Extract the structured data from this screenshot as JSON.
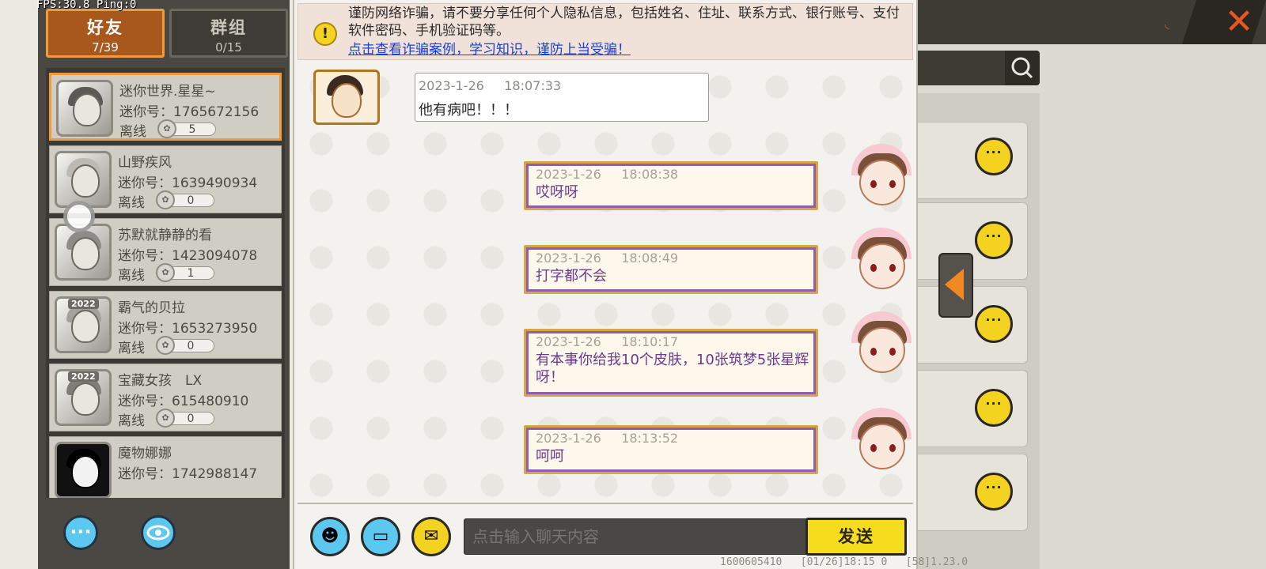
{
  "debug": {
    "fps": "FPS:30.8  Ping:0",
    "footer": "1600605410   [01/26]18:15 0   [58]1.23.0"
  },
  "tabs": {
    "friends": {
      "label": "好友",
      "count": "7/39"
    },
    "groups": {
      "label": "群组",
      "count": "0/15"
    }
  },
  "friends": [
    {
      "name": "迷你世界.星星~",
      "mini": "迷你号：1765672156",
      "status": "离线",
      "level": "5"
    },
    {
      "name": "山野疾风",
      "mini": "迷你号：1639490934",
      "status": "离线",
      "level": "0"
    },
    {
      "name": "苏默就静静的看",
      "mini": "迷你号：1423094078",
      "status": "离线",
      "level": "1"
    },
    {
      "name": "霸气的贝拉",
      "mini": "迷你号：1653273950",
      "status": "离线",
      "level": "0",
      "badge": "2022"
    },
    {
      "name": "宝藏女孩　LX",
      "mini": "迷你号：615480910",
      "status": "离线",
      "level": "0",
      "badge": "2022"
    },
    {
      "name": "魔物娜娜",
      "mini": "迷你号：1742988147",
      "status": "",
      "level": ""
    }
  ],
  "notice": {
    "text": "谨防网络诈骗，请不要分享任何个人隐私信息，包括姓名、住址、联系方式、银行账号、支付软件密码、手机验证码等。",
    "link": "点击查看诈骗案例，学习知识，谨防上当受骗！",
    "icon": "!"
  },
  "messages": [
    {
      "from": "friend",
      "time": "2023-1-26     18:07:33",
      "text": "他有病吧！！！"
    },
    {
      "from": "me",
      "time": "2023-1-26     18:08:38",
      "text": "哎呀呀"
    },
    {
      "from": "me",
      "time": "2023-1-26     18:08:49",
      "text": "打字都不会"
    },
    {
      "from": "me",
      "time": "2023-1-26     18:10:17",
      "text": "有本事你给我10个皮肤，10张筑梦5张星辉呀！"
    },
    {
      "from": "me",
      "time": "2023-1-26     18:13:52",
      "text": "呵呵"
    }
  ],
  "input": {
    "placeholder": "点击输入聊天内容",
    "send_label": "发送"
  },
  "icons": {
    "more": "more-icon",
    "eye": "eye-icon",
    "emoji": "emoji-icon",
    "keyboard": "keyboard-icon",
    "gift": "gift-icon",
    "close": "close-icon",
    "search": "search-icon"
  },
  "colors": {
    "accent_orange": "#f09a3c",
    "send_yellow": "#f5dc1d",
    "link_blue": "#1a3fd8",
    "my_text_purple": "#6a3b8e"
  }
}
